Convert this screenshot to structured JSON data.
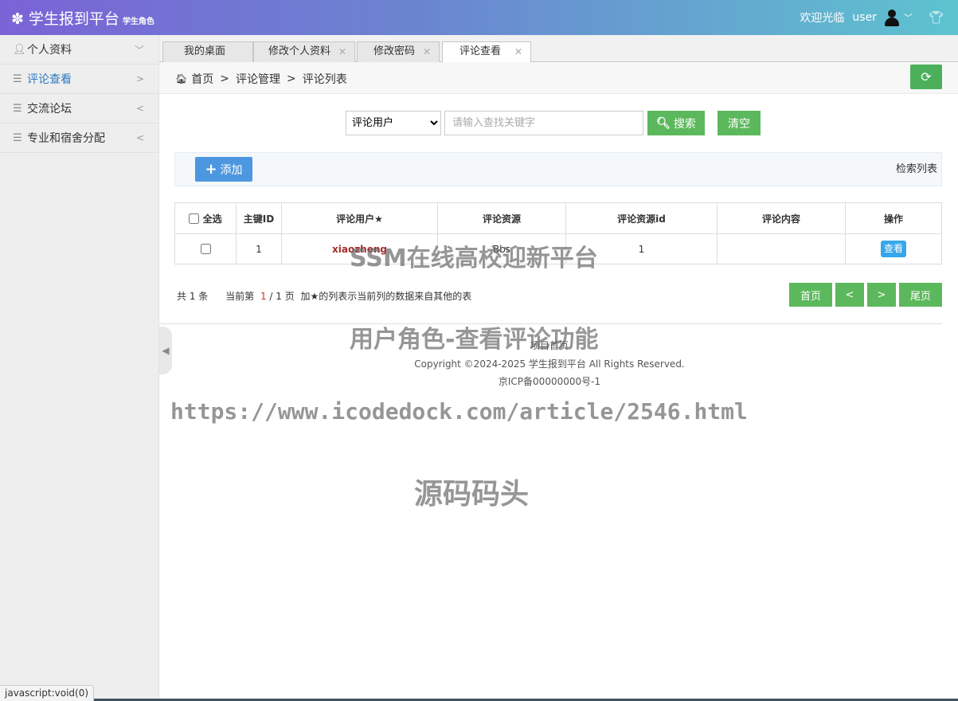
{
  "header": {
    "app_title": "学生报到平台",
    "role_label": "学生角色",
    "welcome": "欢迎光临",
    "username": "user"
  },
  "icons": {
    "logo": "gear-flower-icon",
    "avatar": "user-avatar-icon",
    "theme": "tshirt-icon"
  },
  "sidebar": {
    "items": [
      {
        "label": "个人资料",
        "arrow": "﹀",
        "icon": "person-icon"
      },
      {
        "label": "评论查看",
        "arrow": ">",
        "icon": "menu-lines-icon"
      },
      {
        "label": "交流论坛",
        "arrow": "<",
        "icon": "menu-lines-icon"
      },
      {
        "label": "专业和宿舍分配",
        "arrow": "<",
        "icon": "menu-lines-icon"
      }
    ],
    "collapse_glyph": "◀"
  },
  "tabs": [
    {
      "label": "我的桌面"
    },
    {
      "label": "修改个人资料"
    },
    {
      "label": "修改密码"
    },
    {
      "label": "评论查看"
    }
  ],
  "breadcrumb": {
    "home": "首页",
    "level1": "评论管理",
    "level2": "评论列表",
    "sep": ">"
  },
  "search": {
    "field_selected": "评论用户",
    "placeholder": "请输入查找关键字",
    "search_label": "搜索",
    "clear_label": "清空"
  },
  "toolbar": {
    "add_label": "添加",
    "list_title": "检索列表"
  },
  "table": {
    "headers": [
      "全选",
      "主键ID",
      "评论用户★",
      "评论资源",
      "评论资源id",
      "评论内容",
      "操作"
    ],
    "rows": [
      {
        "id": "1",
        "user": "xiaozheng",
        "resource": "Bbs",
        "resource_id": "1",
        "content": "",
        "action": "查看"
      }
    ]
  },
  "pagination": {
    "total": "共 1 条",
    "current_prefix": "当前第",
    "current": "1",
    "pages_suffix": "/ 1 页",
    "note": "加★的列表示当前列的数据来自其他的表",
    "first": "首页",
    "prev": "<",
    "next": ">",
    "last": "尾页"
  },
  "footer": {
    "link": "项目首页",
    "copyright": "Copyright ©2024-2025 学生报到平台 All Rights Reserved.",
    "icp": "京ICP备00000000号-1"
  },
  "watermarks": {
    "line1": "SSM在线高校迎新平台",
    "line2": "用户角色-查看评论功能",
    "line3": "https://www.icodedock.com/article/2546.html",
    "line4": "源码码头"
  },
  "statusbar": "javascript:void(0)",
  "colors": {
    "header_start": "#7a63d6",
    "header_end": "#5ec3cf",
    "green_button": "#5cb85c",
    "add_button": "#4d97e0",
    "view_button": "#35a7ea",
    "active_menu": "#2b7ac0"
  }
}
